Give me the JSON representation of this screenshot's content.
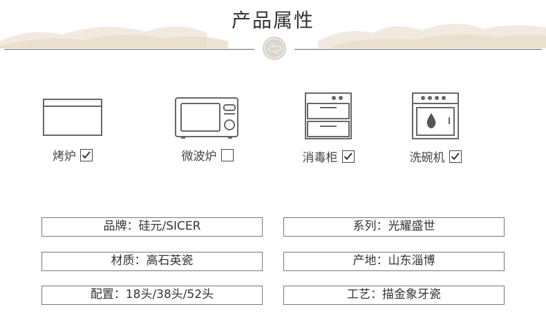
{
  "header": {
    "title": "产品属性"
  },
  "appliances": [
    {
      "label": "烤炉",
      "checked": true
    },
    {
      "label": "微波炉",
      "checked": false
    },
    {
      "label": "消毒柜",
      "checked": true
    },
    {
      "label": "洗碗机",
      "checked": true
    }
  ],
  "attributes": [
    {
      "text": "品牌：硅元/SICER"
    },
    {
      "text": "系列：光耀盛世"
    },
    {
      "text": "材质：高石英瓷"
    },
    {
      "text": "产地：山东淄博"
    },
    {
      "text": "配置：18头/38头/52头"
    },
    {
      "text": "工艺：描金象牙瓷"
    }
  ],
  "colors": {
    "line": "#666666",
    "mountain": "#e9ddc9",
    "text": "#333333"
  }
}
